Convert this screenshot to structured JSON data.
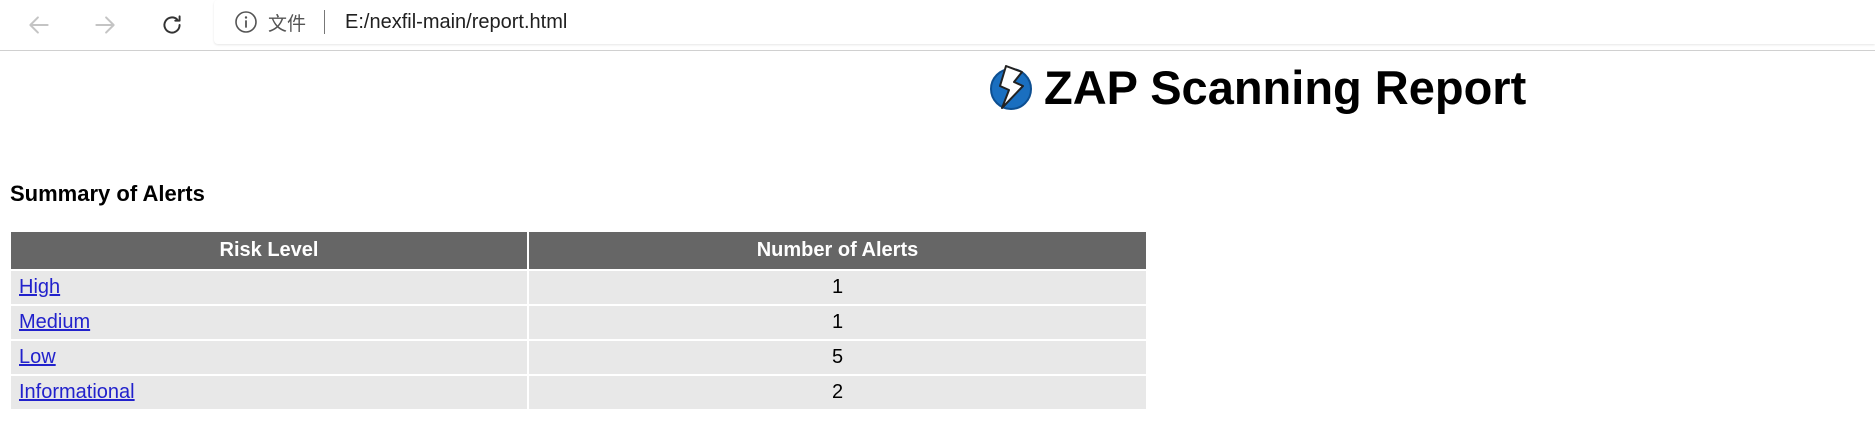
{
  "browser": {
    "site_info_label": "文件",
    "url": "E:/nexfil-main/report.html"
  },
  "report": {
    "title": "ZAP Scanning Report",
    "summary_heading": "Summary of Alerts",
    "table": {
      "headers": [
        "Risk Level",
        "Number of Alerts"
      ],
      "rows": [
        {
          "risk": "High",
          "count": "1"
        },
        {
          "risk": "Medium",
          "count": "1"
        },
        {
          "risk": "Low",
          "count": "5"
        },
        {
          "risk": "Informational",
          "count": "2"
        }
      ]
    }
  },
  "colors": {
    "header_bg": "#666666",
    "row_bg": "#e8e8e8",
    "link": "#2222cc",
    "logo_blue": "#1a6fc0"
  },
  "icons": {
    "back": "arrow-left-icon",
    "forward": "arrow-right-icon",
    "reload": "reload-icon",
    "info": "info-circle-icon",
    "logo": "zap-logo-icon"
  }
}
